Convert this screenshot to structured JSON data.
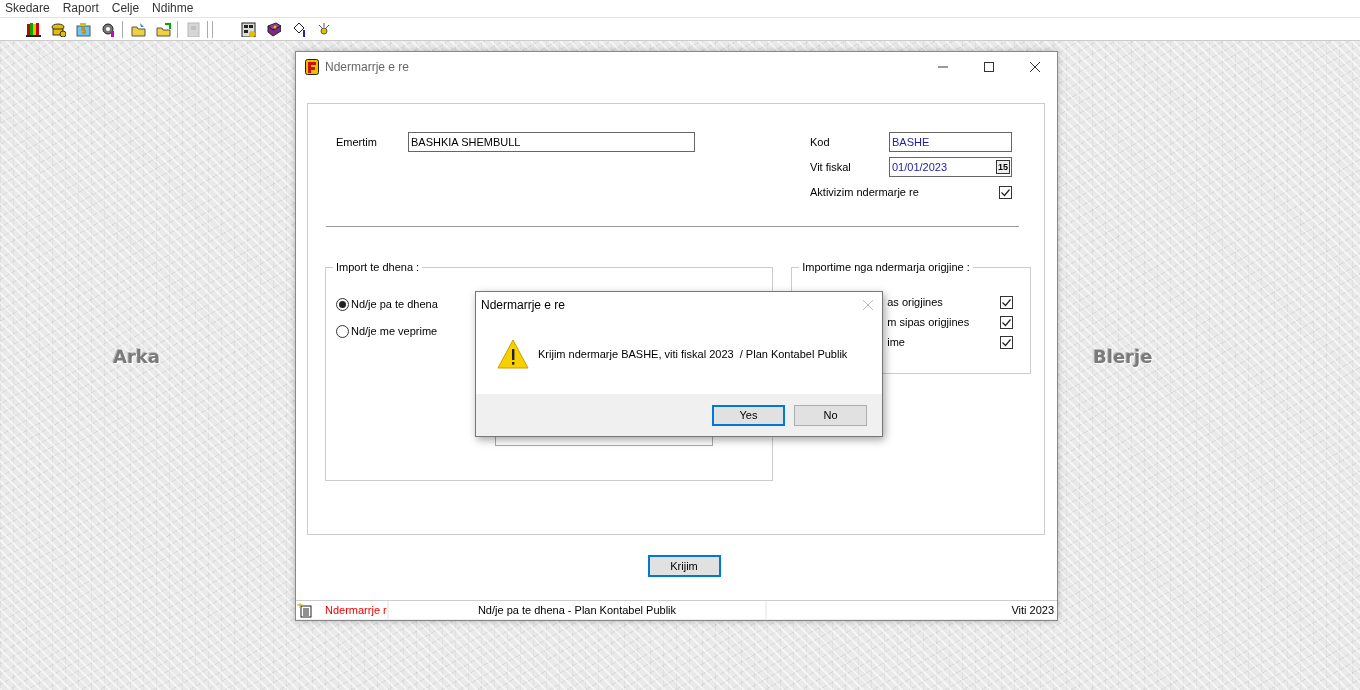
{
  "menu": [
    {
      "label": "Skedare"
    },
    {
      "label": "Raport"
    },
    {
      "label": "Celje"
    },
    {
      "label": "Ndihme"
    }
  ],
  "toolbar": [
    {
      "kind": "button",
      "disabled": false
    },
    {
      "kind": "button",
      "disabled": false
    },
    {
      "kind": "button",
      "disabled": false
    },
    {
      "kind": "button",
      "disabled": false
    },
    {
      "kind": "separator"
    },
    {
      "kind": "button",
      "disabled": false
    },
    {
      "kind": "button",
      "disabled": false
    },
    {
      "kind": "separator"
    },
    {
      "kind": "button",
      "disabled": true
    },
    {
      "kind": "separator"
    },
    {
      "kind": "separator"
    },
    {
      "kind": "spacer"
    },
    {
      "kind": "button",
      "disabled": false
    },
    {
      "kind": "button",
      "disabled": false
    },
    {
      "kind": "button",
      "disabled": false
    },
    {
      "kind": "button",
      "disabled": false
    }
  ],
  "desktop_shortcuts": [
    {
      "label": "Arka"
    },
    {
      "label": "Blerje"
    }
  ],
  "window": {
    "title": "Ndermarrje e re",
    "fields_left": [
      {
        "label": "Emertim",
        "value": "BASHKIA SHEMBULL"
      }
    ],
    "fields_right": [
      {
        "kind": "text",
        "label": "Kod",
        "value": "BASHE"
      },
      {
        "kind": "date",
        "label": "Vit fiskal",
        "value": "01/01/2023",
        "calendar_label": "15"
      },
      {
        "kind": "checkbox",
        "label": "Aktivizim ndermarje re",
        "checked": true
      }
    ],
    "import_group": {
      "title": "Import te dhena :",
      "options": [
        {
          "label": "Nd/je pa te dhena",
          "selected": true
        },
        {
          "label": "Nd/je me veprime",
          "selected": false
        }
      ]
    },
    "origin_group": {
      "title": "Importime nga ndermarja origjine :",
      "items": [
        {
          "label": "as origjines",
          "checked": true
        },
        {
          "label": "m sipas origjines",
          "checked": true
        },
        {
          "label": "ime",
          "checked": true
        }
      ]
    },
    "create_button": {
      "label": "Krijim",
      "focused": true
    },
    "status_bar": {
      "left": "Ndermarrje r",
      "center": "Nd/je pa te dhena - Plan Kontabel Publik",
      "right": "Viti 2023"
    }
  },
  "dialog": {
    "title": "Ndermarrje e re",
    "message": "Krijim ndermarje BASHE, viti fiskal 2023  / Plan Kontabel Publik",
    "buttons": [
      {
        "label": "Yes",
        "focused": true
      },
      {
        "label": "No",
        "focused": false
      }
    ]
  }
}
